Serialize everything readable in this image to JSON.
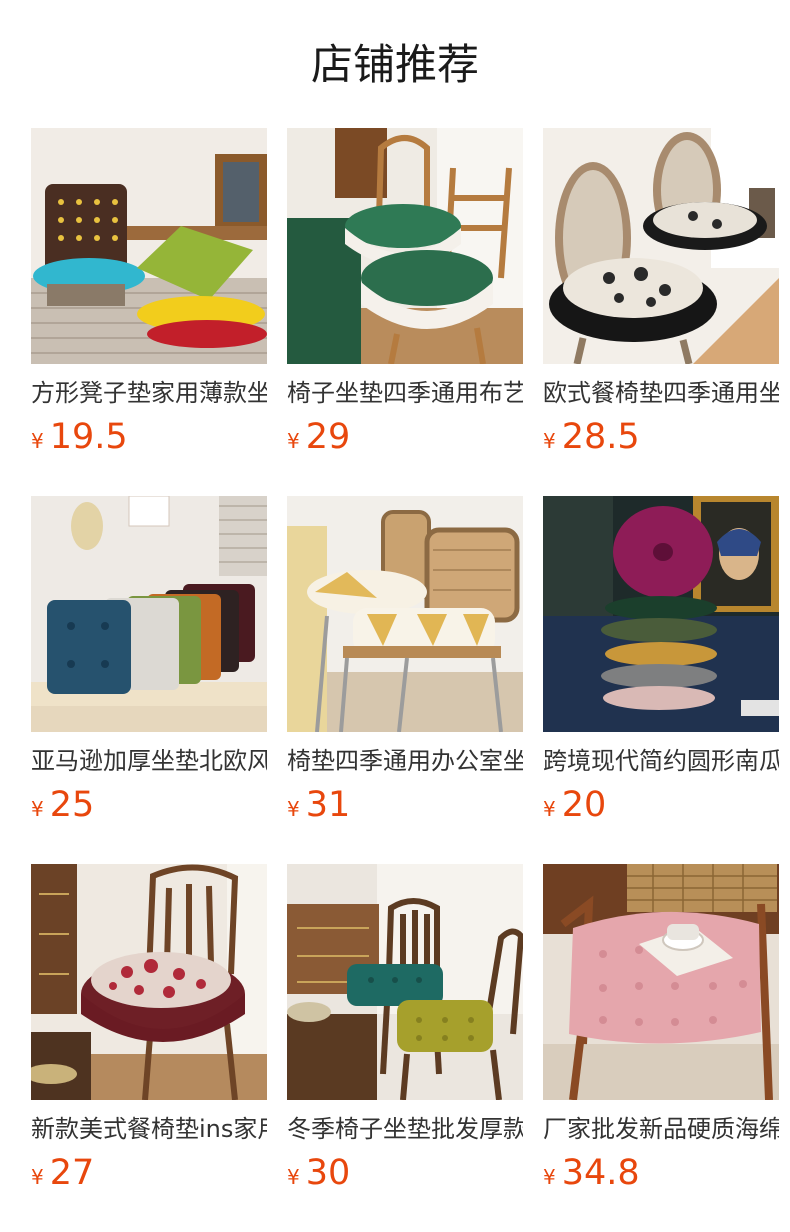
{
  "header": {
    "title": "店铺推荐"
  },
  "products": [
    {
      "name": "方形凳子垫家用薄款坐垫",
      "currency": "¥",
      "price": "19.5",
      "image": "square-tufted-cushions-stack"
    },
    {
      "name": "椅子坐垫四季通用布艺蕾丝",
      "currency": "¥",
      "price": "29",
      "image": "green-lace-chair-pads"
    },
    {
      "name": "欧式餐椅垫四季通用坐垫",
      "currency": "¥",
      "price": "28.5",
      "image": "black-floral-ruffle-seat-pads"
    },
    {
      "name": "亚马逊加厚坐垫北欧风",
      "currency": "¥",
      "price": "25",
      "image": "velvet-square-cushions-row"
    },
    {
      "name": "椅垫四季通用办公室坐垫",
      "currency": "¥",
      "price": "31",
      "image": "yellow-check-cushions-rattan-chairs"
    },
    {
      "name": "跨境现代简约圆形南瓜垫",
      "currency": "¥",
      "price": "20",
      "image": "round-velvet-cushion-stack"
    },
    {
      "name": "新款美式餐椅垫ins家用",
      "currency": "¥",
      "price": "27",
      "image": "burgundy-rose-ruffle-seat-pad"
    },
    {
      "name": "冬季椅子坐垫批发厚款",
      "currency": "¥",
      "price": "30",
      "image": "teal-olive-tufted-cushions"
    },
    {
      "name": "厂家批发新品硬质海绵垫",
      "currency": "¥",
      "price": "34.8",
      "image": "pink-tufted-cushion-armchair"
    }
  ],
  "colors": {
    "price": "#e8470d",
    "title": "#1a1a1a",
    "name": "#333333"
  }
}
